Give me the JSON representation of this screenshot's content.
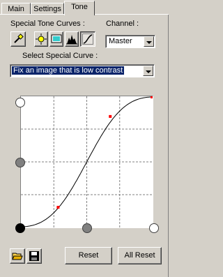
{
  "tabs": [
    {
      "label": "Main"
    },
    {
      "label": "Settings"
    },
    {
      "label": "Tone"
    }
  ],
  "special_tone_curves": {
    "label": "Special Tone Curves :",
    "tools": [
      {
        "icon": "eyedropper-icon"
      },
      {
        "icon": "brightness-icon"
      },
      {
        "icon": "monitor-icon"
      },
      {
        "icon": "histogram-icon"
      },
      {
        "icon": "curve-icon"
      }
    ]
  },
  "channel": {
    "label": "Channel :",
    "value": "Master"
  },
  "select_curve": {
    "label": "Select Special Curve :",
    "value": "Fix an image that is low contrast"
  },
  "curve": {
    "control_points": [
      [
        0.0,
        0.0
      ],
      [
        0.28,
        0.15
      ],
      [
        0.68,
        0.85
      ],
      [
        1.0,
        1.0
      ]
    ]
  },
  "buttons": {
    "open_icon": "folder-open-icon",
    "save_icon": "floppy-icon",
    "reset": "Reset",
    "all_reset": "All Reset"
  }
}
